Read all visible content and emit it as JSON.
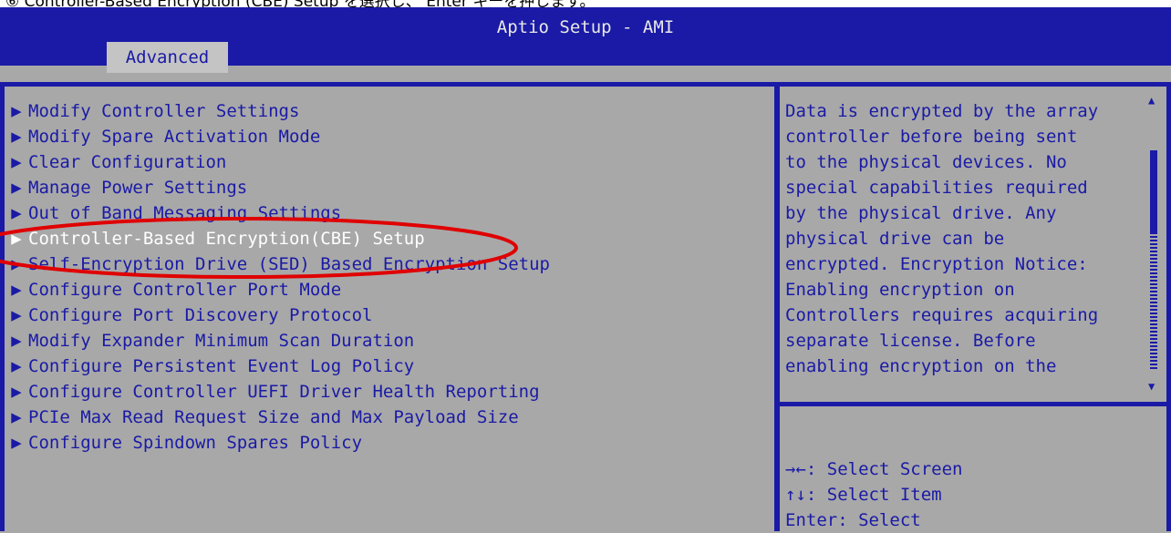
{
  "caption": "⑥  Controller-Based Encryption (CBE) Setup を選択し、 Enter キーを押します。",
  "title": "Aptio Setup - AMI",
  "tab": "Advanced",
  "menu": [
    {
      "label": "Modify Controller Settings",
      "selected": false
    },
    {
      "label": "Modify Spare Activation Mode",
      "selected": false
    },
    {
      "label": "Clear Configuration",
      "selected": false
    },
    {
      "label": "Manage Power Settings",
      "selected": false
    },
    {
      "label": "Out of Band Messaging Settings",
      "selected": false
    },
    {
      "label": "Controller-Based Encryption(CBE) Setup",
      "selected": true
    },
    {
      "label": "Self-Encryption Drive (SED) Based Encryption Setup",
      "selected": false
    },
    {
      "label": "Configure Controller Port Mode",
      "selected": false
    },
    {
      "label": "Configure Port Discovery Protocol",
      "selected": false
    },
    {
      "label": "Modify Expander Minimum Scan Duration",
      "selected": false
    },
    {
      "label": "Configure Persistent Event Log Policy",
      "selected": false
    },
    {
      "label": "Configure Controller UEFI Driver Health Reporting",
      "selected": false
    },
    {
      "label": "PCIe Max Read Request Size and Max Payload Size",
      "selected": false
    },
    {
      "label": "Configure Spindown Spares Policy",
      "selected": false
    }
  ],
  "help_lines": [
    "Data is encrypted by the array",
    "controller before being sent",
    "to the physical devices. No",
    "special capabilities required",
    "by the physical drive. Any",
    "physical drive can be",
    "encrypted. Encryption Notice:",
    "Enabling encryption on",
    "Controllers requires acquiring",
    "separate license. Before",
    "enabling encryption on the"
  ],
  "keys": [
    "→←: Select Screen",
    "↑↓: Select Item",
    "Enter: Select"
  ],
  "colors": {
    "frame": "#1a1aa6",
    "panel": "#a8a8a8",
    "selected_text": "#ffffff",
    "highlight_ring": "#e00000"
  }
}
